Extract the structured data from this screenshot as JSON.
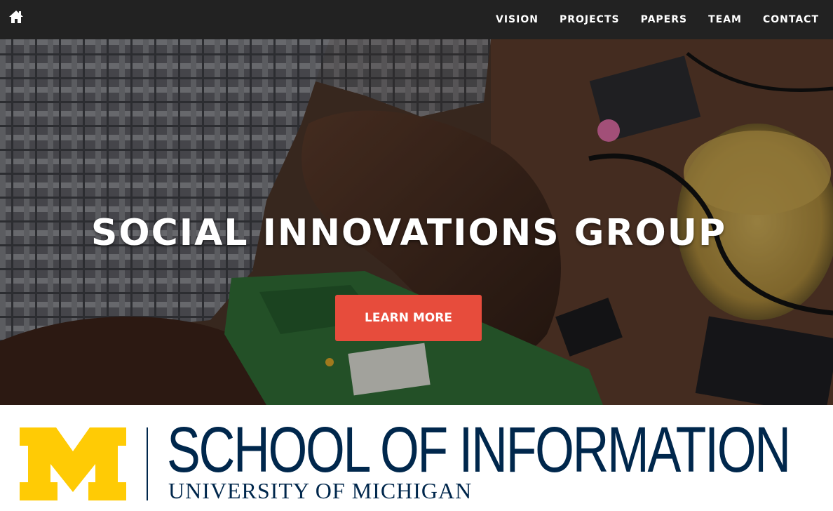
{
  "nav": {
    "home_icon": "home-icon",
    "items": [
      {
        "label": "VISION"
      },
      {
        "label": "PROJECTS"
      },
      {
        "label": "PAPERS"
      },
      {
        "label": "TEAM"
      },
      {
        "label": "CONTACT"
      }
    ]
  },
  "hero": {
    "title": "SOCIAL INNOVATIONS GROUP",
    "button_label": "LEARN MORE"
  },
  "footer": {
    "logo_letter": "M",
    "school_name": "SCHOOL OF INFORMATION",
    "university_name": "UNIVERSITY OF MICHIGAN"
  },
  "colors": {
    "navbar": "#222222",
    "button": "#e74c3c",
    "michigan_maize": "#ffcb05",
    "michigan_blue": "#00274c"
  }
}
